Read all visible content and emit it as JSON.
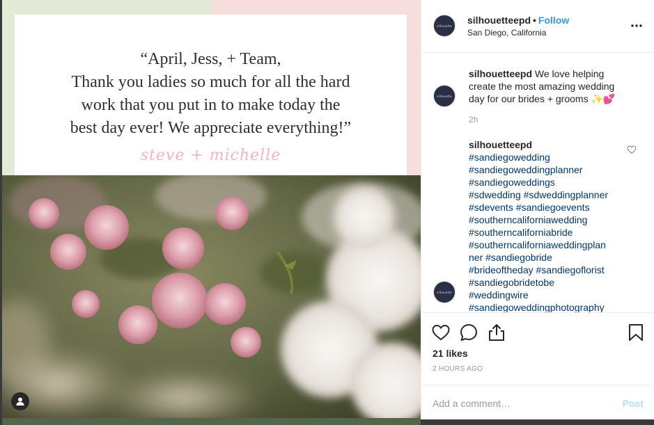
{
  "post_image": {
    "quote_lines": [
      "“April, Jess, + Team,",
      "Thank you ladies so much for all the hard",
      "work that you put in to make today the",
      "best day ever! We appreciate everything!”"
    ],
    "signature": "steve + michelle"
  },
  "header": {
    "avatar_text": "silhouette",
    "username": "silhouetteepd",
    "separator": "•",
    "follow_label": "Follow",
    "location": "San Diego, California",
    "more_icon": "more-horizontal-icon"
  },
  "caption": {
    "username": "silhouetteepd",
    "text": "We love helping create the most amazing wedding day for our brides + grooms ✨💕",
    "time": "2h"
  },
  "hashtag_comment": {
    "username": "silhouetteepd",
    "lines": [
      "#sandiegowedding",
      "#sandiegoweddingplanner",
      "#sandiegoweddings",
      "#sdwedding #sdweddingplanner",
      "#sdevents #sandiegoevents",
      "#southerncaliforniawedding",
      "#southerncaliforniabride",
      "#southerncaliforniaweddingplan",
      "ner #sandiegobride",
      "#brideoftheday #sandiegoflorist",
      "#sandiegobridetobe",
      "#weddingwire",
      "#sandiegoweddingphotography"
    ]
  },
  "actions": {
    "likes": "21 likes",
    "posted_ago": "2 HOURS AGO"
  },
  "comment_box": {
    "placeholder": "Add a comment…",
    "post_label": "Post"
  },
  "colors": {
    "accent": "#3897f0",
    "hashtag": "#003569",
    "post_disabled": "#b2dffc"
  }
}
